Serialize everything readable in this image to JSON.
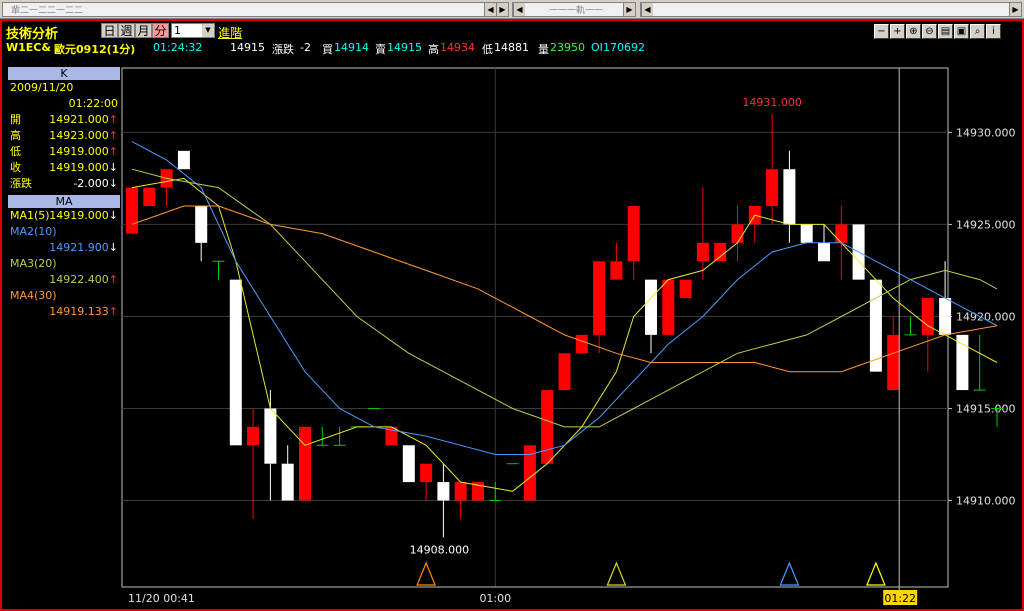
{
  "window": {
    "top_fragment_1": "軰二一二二一二二",
    "top_fragment_2": "一一一軌一一"
  },
  "toolbar": {
    "title": "技術分析",
    "timeframes": [
      {
        "label": "日",
        "active": false
      },
      {
        "label": "週",
        "active": false
      },
      {
        "label": "月",
        "active": false
      },
      {
        "label": "分",
        "active": true
      }
    ],
    "interval_value": "1",
    "advanced_link": "進階",
    "icons": [
      "minus-icon",
      "plus-icon",
      "zoom-in-icon",
      "zoom-out-icon",
      "window-icon",
      "save-icon",
      "search-icon",
      "info-icon"
    ]
  },
  "quote": {
    "symbol": "W1EC&",
    "name": "歐元0912(1分)",
    "time": "01:24:32",
    "last": "14915",
    "change_label": "漲跌",
    "change": "-2",
    "bid_label": "買",
    "bid": "14914",
    "ask_label": "賣",
    "ask": "14915",
    "high_label": "高",
    "high": "14934",
    "low_label": "低",
    "low": "14881",
    "vol_label": "量",
    "vol": "23950",
    "oi_label": "OI",
    "oi": "170692"
  },
  "left_panel": {
    "k_header": "K",
    "date": "2009/11/20",
    "time": "01:22:00",
    "rows": [
      {
        "label": "開",
        "value": "14921.000",
        "arrow": "↑"
      },
      {
        "label": "高",
        "value": "14923.000",
        "arrow": "↑"
      },
      {
        "label": "低",
        "value": "14919.000",
        "arrow": "↑"
      },
      {
        "label": "收",
        "value": "14919.000",
        "arrow": "↓"
      },
      {
        "label": "漲跌",
        "value": "-2.000",
        "arrow": "↓"
      }
    ],
    "ma_header": "MA",
    "ma1": {
      "label": "MA1(5)",
      "value": "14919.000",
      "arrow": "↓",
      "color": "#ffff00"
    },
    "ma2": {
      "label": "MA2(10)",
      "value": "14921.900",
      "arrow": "↓",
      "color": "#4a9cff"
    },
    "ma3": {
      "label": "MA3(20)",
      "value": "14922.400",
      "arrow": "↑",
      "color": "#b6d24a"
    },
    "ma4": {
      "label": "MA4(30)",
      "value": "14919.133",
      "arrow": "↑",
      "color": "#ff9933"
    }
  },
  "chart_data": {
    "type": "candlestick",
    "y_ticks": [
      "14910.000",
      "14915.000",
      "14920.000",
      "14925.000",
      "14930.000"
    ],
    "ylim": [
      14905.3,
      14933.5
    ],
    "x_labels": {
      "start": "11/20 00:41",
      "mid": "01:00",
      "cursor": "01:22"
    },
    "annotations": {
      "high": "14931.000",
      "low": "14908.000"
    },
    "candles": [
      {
        "o": 14924.5,
        "h": 14927,
        "l": 14924.5,
        "c": 14927,
        "hide_low_wick": true
      },
      {
        "o": 14926,
        "h": 14927,
        "l": 14926,
        "c": 14927
      },
      {
        "o": 14927,
        "h": 14928,
        "l": 14926,
        "c": 14928
      },
      {
        "o": 14929,
        "h": 14929,
        "l": 14928,
        "c": 14928
      },
      {
        "o": 14926,
        "h": 14926,
        "l": 14923,
        "c": 14924
      },
      {
        "o": 14923,
        "h": 14923,
        "l": 14922,
        "c": 14923
      },
      {
        "o": 14922,
        "h": 14922,
        "l": 14913,
        "c": 14913
      },
      {
        "o": 14913,
        "h": 14915,
        "l": 14909,
        "c": 14914
      },
      {
        "o": 14915,
        "h": 14916,
        "l": 14910,
        "c": 14912
      },
      {
        "o": 14912,
        "h": 14913,
        "l": 14910,
        "c": 14910
      },
      {
        "o": 14910,
        "h": 14914,
        "l": 14910,
        "c": 14914
      },
      {
        "o": 14913,
        "h": 14914,
        "l": 14913,
        "c": 14913
      },
      {
        "o": 14913,
        "h": 14914,
        "l": 14913,
        "c": 14913
      },
      {
        "o": 14914,
        "h": 14914,
        "l": 14914,
        "c": 14914
      },
      {
        "o": 14915,
        "h": 14915,
        "l": 14915,
        "c": 14915
      },
      {
        "o": 14913,
        "h": 14914,
        "l": 14913,
        "c": 14914
      },
      {
        "o": 14913,
        "h": 14913,
        "l": 14911,
        "c": 14911
      },
      {
        "o": 14911,
        "h": 14912,
        "l": 14910,
        "c": 14912
      },
      {
        "o": 14911,
        "h": 14912,
        "l": 14908,
        "c": 14910
      },
      {
        "o": 14910,
        "h": 14910,
        "l": 14909,
        "c": 14911
      },
      {
        "o": 14910,
        "h": 14911,
        "l": 14910,
        "c": 14911
      },
      {
        "o": 14910,
        "h": 14911,
        "l": 14910,
        "c": 14910
      },
      {
        "o": 14912,
        "h": 14912,
        "l": 14912,
        "c": 14912
      },
      {
        "o": 14910,
        "h": 14913,
        "l": 14910,
        "c": 14913
      },
      {
        "o": 14912,
        "h": 14916,
        "l": 14912,
        "c": 14916
      },
      {
        "o": 14916,
        "h": 14918,
        "l": 14916,
        "c": 14918
      },
      {
        "o": 14918,
        "h": 14919,
        "l": 14918,
        "c": 14919
      },
      {
        "o": 14919,
        "h": 14923,
        "l": 14918,
        "c": 14923
      },
      {
        "o": 14922,
        "h": 14924,
        "l": 14922,
        "c": 14923
      },
      {
        "o": 14923,
        "h": 14926,
        "l": 14922,
        "c": 14926
      },
      {
        "o": 14922,
        "h": 14922,
        "l": 14918,
        "c": 14919
      },
      {
        "o": 14919,
        "h": 14922,
        "l": 14919,
        "c": 14922
      },
      {
        "o": 14921,
        "h": 14922,
        "l": 14921,
        "c": 14922
      },
      {
        "o": 14923,
        "h": 14927,
        "l": 14922,
        "c": 14924
      },
      {
        "o": 14923,
        "h": 14924,
        "l": 14923,
        "c": 14924
      },
      {
        "o": 14924,
        "h": 14926,
        "l": 14923,
        "c": 14925
      },
      {
        "o": 14925,
        "h": 14926,
        "l": 14924,
        "c": 14926
      },
      {
        "o": 14926,
        "h": 14931,
        "l": 14925,
        "c": 14928
      },
      {
        "o": 14928,
        "h": 14929,
        "l": 14924,
        "c": 14925
      },
      {
        "o": 14925,
        "h": 14925,
        "l": 14924,
        "c": 14924
      },
      {
        "o": 14924,
        "h": 14925,
        "l": 14923,
        "c": 14923
      },
      {
        "o": 14924,
        "h": 14926,
        "l": 14922,
        "c": 14925
      },
      {
        "o": 14925,
        "h": 14925,
        "l": 14922,
        "c": 14922
      },
      {
        "o": 14922,
        "h": 14922,
        "l": 14917,
        "c": 14917
      },
      {
        "o": 14916,
        "h": 14920,
        "l": 14916,
        "c": 14919
      },
      {
        "o": 14919,
        "h": 14920,
        "l": 14919,
        "c": 14919
      },
      {
        "o": 14919,
        "h": 14921,
        "l": 14917,
        "c": 14921
      },
      {
        "o": 14921,
        "h": 14923,
        "l": 14919,
        "c": 14919
      },
      {
        "o": 14919,
        "h": 14919,
        "l": 14916,
        "c": 14916
      },
      {
        "o": 14916,
        "h": 14919,
        "l": 14916,
        "c": 14916
      },
      {
        "o": 14915,
        "h": 14915,
        "l": 14914,
        "c": 14915
      }
    ],
    "ma_lines": [
      {
        "name": "MA1(5)",
        "color": "#e8e82a",
        "points": [
          [
            0,
            14927
          ],
          [
            3,
            14927.5
          ],
          [
            5,
            14926
          ],
          [
            6,
            14923
          ],
          [
            7,
            14919
          ],
          [
            8,
            14915
          ],
          [
            10,
            14913
          ],
          [
            13,
            14914
          ],
          [
            15,
            14914
          ],
          [
            17,
            14913
          ],
          [
            19,
            14911
          ],
          [
            22,
            14910.5
          ],
          [
            24,
            14912
          ],
          [
            26,
            14914
          ],
          [
            28,
            14917
          ],
          [
            29,
            14920
          ],
          [
            31,
            14922
          ],
          [
            33,
            14922.5
          ],
          [
            35,
            14924
          ],
          [
            36,
            14925.5
          ],
          [
            38,
            14925
          ],
          [
            40,
            14925
          ],
          [
            42,
            14923
          ],
          [
            44,
            14921
          ],
          [
            46,
            14919.5
          ],
          [
            48,
            14918.5
          ],
          [
            50,
            14917.5
          ]
        ]
      },
      {
        "name": "MA2(10)",
        "color": "#4a9cff",
        "points": [
          [
            0,
            14929.5
          ],
          [
            2,
            14928.5
          ],
          [
            4,
            14927
          ],
          [
            6,
            14923
          ],
          [
            8,
            14920
          ],
          [
            10,
            14917
          ],
          [
            12,
            14915
          ],
          [
            14,
            14914
          ],
          [
            17,
            14913.5
          ],
          [
            19,
            14913
          ],
          [
            21,
            14912.5
          ],
          [
            23,
            14912.5
          ],
          [
            25,
            14913
          ],
          [
            27,
            14914.5
          ],
          [
            29,
            14916.5
          ],
          [
            31,
            14918.5
          ],
          [
            33,
            14920
          ],
          [
            35,
            14922
          ],
          [
            37,
            14923.5
          ],
          [
            39,
            14924
          ],
          [
            41,
            14924
          ],
          [
            43,
            14923
          ],
          [
            45,
            14922
          ],
          [
            47,
            14921
          ],
          [
            50,
            14919.5
          ]
        ]
      },
      {
        "name": "MA3(20)",
        "color": "#b6d24a",
        "points": [
          [
            0,
            14928
          ],
          [
            2,
            14927.5
          ],
          [
            5,
            14927
          ],
          [
            8,
            14925
          ],
          [
            10,
            14923
          ],
          [
            13,
            14920
          ],
          [
            16,
            14918
          ],
          [
            19,
            14916.5
          ],
          [
            22,
            14915
          ],
          [
            25,
            14914
          ],
          [
            27,
            14914
          ],
          [
            29,
            14915
          ],
          [
            31,
            14916
          ],
          [
            33,
            14917
          ],
          [
            35,
            14918
          ],
          [
            37,
            14918.5
          ],
          [
            39,
            14919
          ],
          [
            41,
            14920
          ],
          [
            43,
            14921
          ],
          [
            45,
            14922
          ],
          [
            47,
            14922.5
          ],
          [
            49,
            14922
          ],
          [
            50,
            14921.5
          ]
        ]
      },
      {
        "name": "MA4(30)",
        "color": "#ff9933",
        "points": [
          [
            0,
            14925
          ],
          [
            3,
            14926
          ],
          [
            5,
            14926
          ],
          [
            8,
            14925
          ],
          [
            11,
            14924.5
          ],
          [
            14,
            14923.5
          ],
          [
            17,
            14922.5
          ],
          [
            20,
            14921.5
          ],
          [
            23,
            14920
          ],
          [
            25,
            14919
          ],
          [
            28,
            14918
          ],
          [
            30,
            14917.5
          ],
          [
            33,
            14917.5
          ],
          [
            36,
            14917.5
          ],
          [
            38,
            14917
          ],
          [
            41,
            14917
          ],
          [
            44,
            14918
          ],
          [
            47,
            14919
          ],
          [
            50,
            14919.5
          ]
        ]
      }
    ],
    "markers": [
      {
        "i": 17,
        "color": "#ff8c00"
      },
      {
        "i": 28,
        "color": "#d8d820"
      },
      {
        "i": 38,
        "color": "#4a9cff"
      },
      {
        "i": 43,
        "color": "#ffff00"
      }
    ],
    "cursor_index": 44
  }
}
